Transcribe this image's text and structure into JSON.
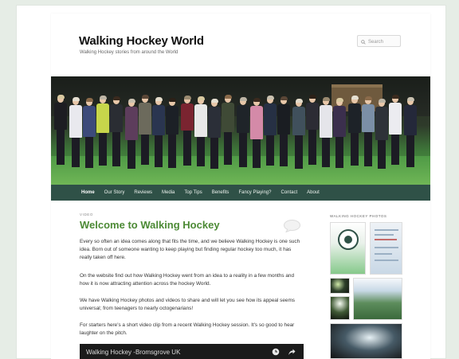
{
  "site": {
    "title": "Walking Hockey World",
    "tagline": "Walking Hockey stories from around the World"
  },
  "search": {
    "placeholder": "Search"
  },
  "nav": {
    "items": [
      {
        "label": "Home",
        "active": true
      },
      {
        "label": "Our Story"
      },
      {
        "label": "Reviews"
      },
      {
        "label": "Media"
      },
      {
        "label": "Top Tips"
      },
      {
        "label": "Benefits"
      },
      {
        "label": "Fancy Playing?"
      },
      {
        "label": "Contact"
      },
      {
        "label": "About"
      }
    ]
  },
  "post": {
    "format": "VIDEO",
    "title": "Welcome to Walking Hockey",
    "paragraphs": [
      "Every so often an idea comes along that fits the time, and we believe Walking Hockey is one such idea. Born out of someone wanting to keep playing but finding regular hockey too much, it has really taken off here.",
      "On the website find out how Walking Hockey went from an idea to a reality in a few months and how it is now attracting attention across the hockey World.",
      "We have Walking Hockey photos and videos to share and will let you see how its appeal seems universal; from teenagers to nearly octogenarians!",
      "For starters here's a short video clip from a recent Walking Hockey session. It's so good to hear laughter on the pitch."
    ],
    "video": {
      "title": "Walking Hockey -Bromsgrove UK"
    }
  },
  "sidebar": {
    "widget_title": "WALKING HOCKEY PHOTOS"
  },
  "colors": {
    "nav_bg": "#2f5147",
    "title_green": "#4c8a35",
    "page_bg": "#e6ede6"
  },
  "icons": [
    "search-icon",
    "comment-bubble-icon",
    "clock-icon",
    "share-icon"
  ]
}
